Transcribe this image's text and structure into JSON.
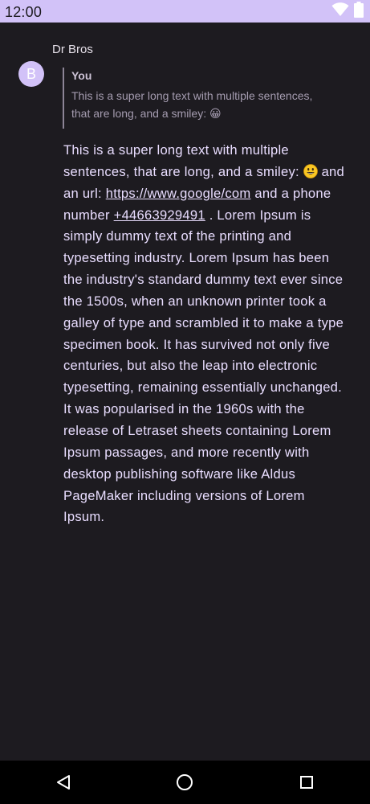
{
  "status_bar": {
    "time": "12:00",
    "icons": [
      "wifi-icon",
      "battery-icon"
    ]
  },
  "message": {
    "sender": "Dr Bros",
    "avatar_letter": "B",
    "reply": {
      "author": "You",
      "text": "This is a super long text with multiple sentences, that are long, and a smiley: 😀"
    },
    "body": {
      "part1": "This is a super long text with multiple sentences, that are long, and a smiley: ",
      "emoji": "😀",
      "part2": " and an url: ",
      "url": "https://www.google/com",
      "part3": " and a phone number ",
      "phone": "+44663929491",
      "part4": " . Lorem Ipsum is simply dummy text of the printing and typesetting industry. Lorem Ipsum has been the industry's standard dummy text ever since the 1500s, when an unknown printer took a galley of type and scrambled it to make a type specimen book. It has survived not only five centuries, but also the leap into electronic typesetting, remaining essentially unchanged. It was popularised in the 1960s with the release of Letraset sheets containing Lorem Ipsum passages, and more recently with desktop publishing software like Aldus PageMaker including versions of Lorem Ipsum."
    }
  },
  "nav_bar": {
    "buttons": [
      "back-icon",
      "home-icon",
      "recents-icon"
    ]
  },
  "colors": {
    "background": "#1d1b20",
    "status_bar": "#d2c2f8",
    "avatar": "#d2c2f8",
    "message_text": "#e9ddff",
    "quote_text": "#a59cb0"
  }
}
